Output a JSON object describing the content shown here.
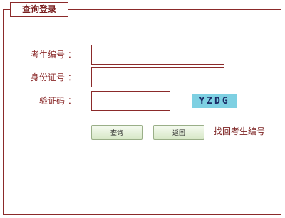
{
  "panel": {
    "title": "查询登录"
  },
  "form": {
    "exam_number_label": "考生编号 ：",
    "id_number_label": "身份证号 ：",
    "captcha_label": "验证码 ：",
    "exam_number_value": "",
    "id_number_value": "",
    "captcha_value": "",
    "captcha_image_text": "YZDG"
  },
  "buttons": {
    "query_label": "查询",
    "back_label": "返回"
  },
  "links": {
    "recover_exam_number": "找回考生编号"
  },
  "colors": {
    "border": "#8b2a2a",
    "text": "#8b2a2a",
    "captcha_bg": "#7ed0e2",
    "button_bg": "#d7e8c7"
  }
}
